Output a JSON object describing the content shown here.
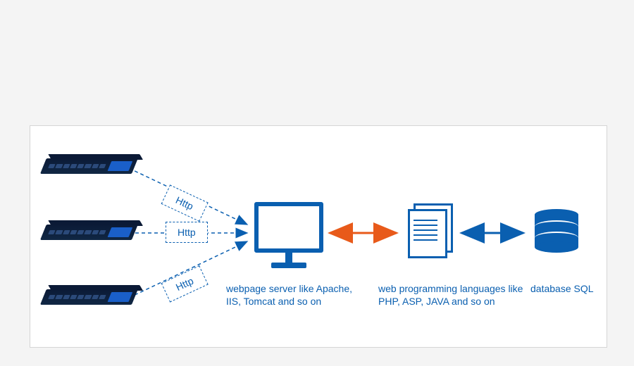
{
  "diagram": {
    "http_labels": [
      "Http",
      "Http",
      "Http"
    ],
    "captions": {
      "server": "webpage server like Apache, IIS, Tomcat and so on",
      "languages": "web programming languages like PHP, ASP, JAVA and so on",
      "database": "database SQL"
    },
    "nodes": {
      "devices": [
        "rack-device-1",
        "rack-device-2",
        "rack-device-3"
      ],
      "server": "monitor-icon",
      "languages": "document-icon",
      "database": "database-cylinder-icon"
    },
    "arrows": {
      "device_to_server": {
        "count": 3,
        "style": "dashed",
        "color": "#0a5fb0",
        "direction": "right"
      },
      "server_to_languages": {
        "style": "solid",
        "color": "#e85a1a",
        "direction": "both"
      },
      "languages_to_database": {
        "style": "solid",
        "color": "#0a5fb0",
        "direction": "both"
      }
    },
    "colors": {
      "primary": "#0a5fb0",
      "accent": "#e85a1a",
      "panel_bg": "#ffffff",
      "page_bg": "#f4f4f4"
    }
  }
}
